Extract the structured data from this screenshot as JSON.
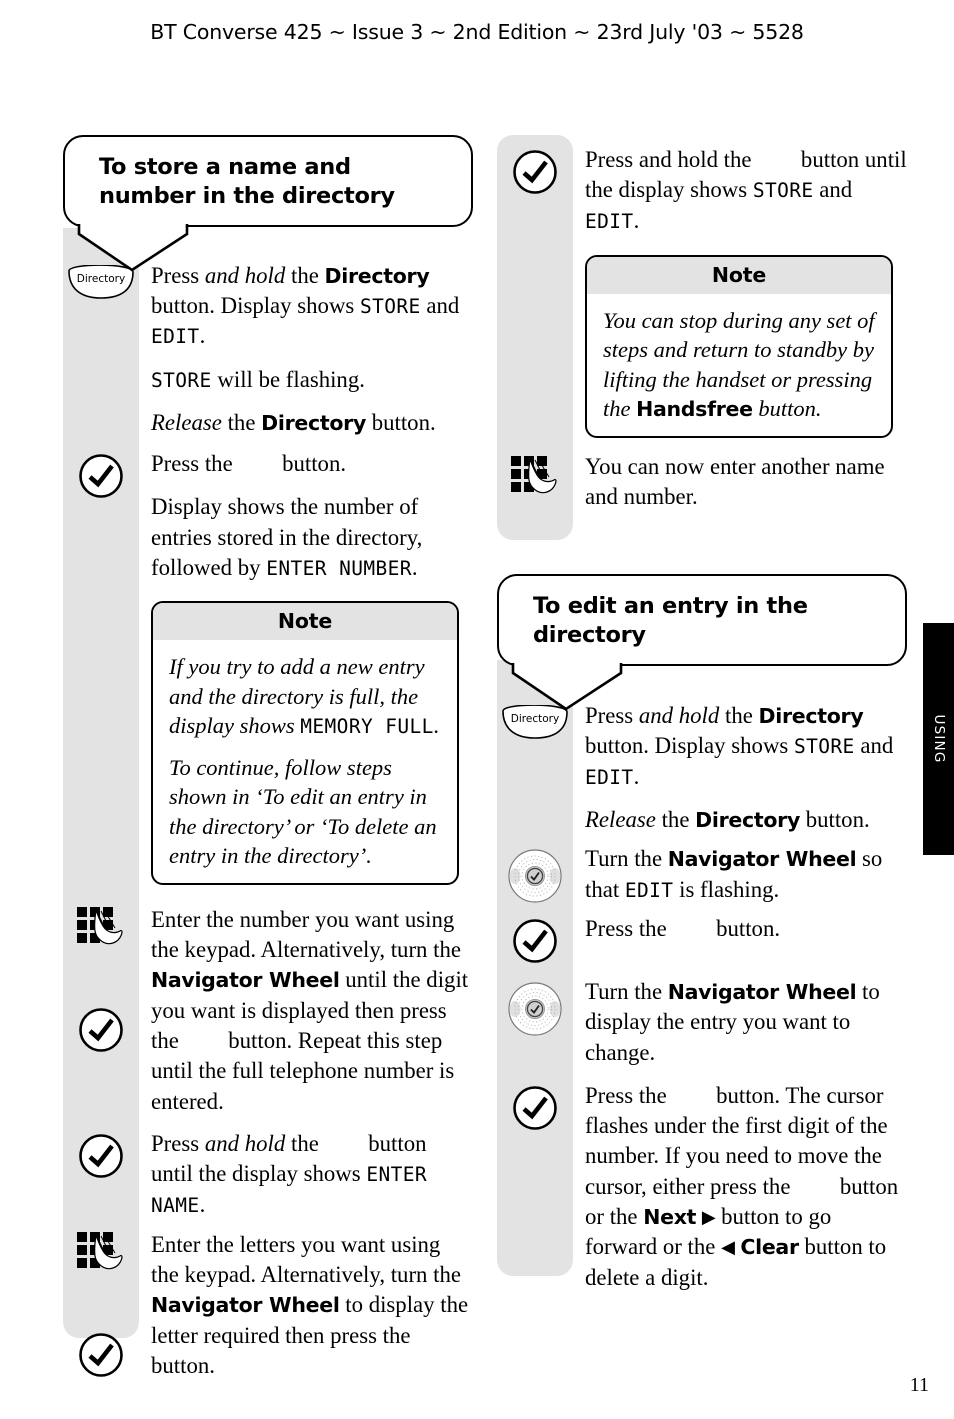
{
  "header": {
    "title": "BT Converse 425 ~ Issue 3 ~ 2nd Edition ~ 23rd July '03 ~ 5528"
  },
  "side_tab": {
    "label": "USING"
  },
  "page_number": "11",
  "labels": {
    "note_heading": "Note",
    "directory_button": "Directory"
  },
  "left_column": {
    "callout_title": "To store a name and number in the directory",
    "steps": [
      {
        "icon": "directory-button-icon",
        "paragraphs": [
          "Press and hold the Directory button. Display shows STORE and EDIT.",
          "STORE will be flashing.",
          "Release the Directory button."
        ]
      },
      {
        "icon": "check-circle-icon",
        "paragraphs": [
          "Press the button.",
          "Display shows the number of entries stored in the directory, followed by ENTER NUMBER."
        ]
      }
    ],
    "note": {
      "heading": "Note",
      "paragraphs": [
        "If you try to add a new entry and the directory is full, the display shows MEMORY FULL.",
        "To continue, follow steps shown in 'To edit an entry in the directory' or 'To delete an entry in the directory'."
      ]
    },
    "steps2": [
      {
        "icon": "keypad-icon",
        "text": "Enter the number you want using the keypad. Alternatively, turn the Navigator Wheel until the digit you want is displayed then press the button. Repeat this step until the full telephone number is entered."
      },
      {
        "icon": "check-circle-icon",
        "text": "Press and hold the button until the display shows ENTER NAME."
      },
      {
        "icon": "keypad-icon",
        "text": "Enter the letters you want using the keypad. Alternatively, turn the Navigator Wheel to display the letter required then press the button."
      }
    ]
  },
  "right_column": {
    "top_step": {
      "icon": "check-circle-icon",
      "text": "Press and hold the button until the display shows STORE and EDIT."
    },
    "note": {
      "heading": "Note",
      "paragraphs": [
        "You can stop during any set of steps and return to standby by lifting the handset or pressing the Handsfree button."
      ]
    },
    "after_note_step": {
      "icon": "keypad-icon",
      "text": "You can now enter another name and number."
    },
    "callout_title": "To edit an entry in the directory",
    "steps": [
      {
        "icon": "directory-button-icon",
        "paragraphs": [
          "Press and hold the Directory button. Display shows STORE and EDIT.",
          "Release the Directory button."
        ]
      },
      {
        "icon": "navigator-wheel-icon",
        "text": "Turn the Navigator Wheel so that EDIT is flashing."
      },
      {
        "icon": "check-circle-icon",
        "text": "Press the button."
      },
      {
        "icon": "navigator-wheel-icon",
        "text": "Turn the Navigator Wheel to display the entry you want to change."
      },
      {
        "icon": "check-circle-icon",
        "text": "Press the button. The cursor flashes under the first digit of the number. If you need to move the cursor, either press the button or the Next ▶ button to go forward or the ◀ Clear button to delete a digit."
      }
    ]
  },
  "inline_terms": {
    "and_hold": "and hold",
    "release": "Release",
    "directory": "Directory",
    "navigator_wheel": "Navigator Wheel",
    "handsfree": "Handsfree",
    "next": "Next",
    "clear": "Clear",
    "store": "STORE",
    "edit": "EDIT",
    "enter_number": "ENTER NUMBER",
    "enter_name": "ENTER NAME",
    "memory_full": "MEMORY FULL"
  },
  "colors": {
    "gutter_gray": "#e3e3e3",
    "tab_black": "#000000",
    "page_white": "#ffffff"
  }
}
